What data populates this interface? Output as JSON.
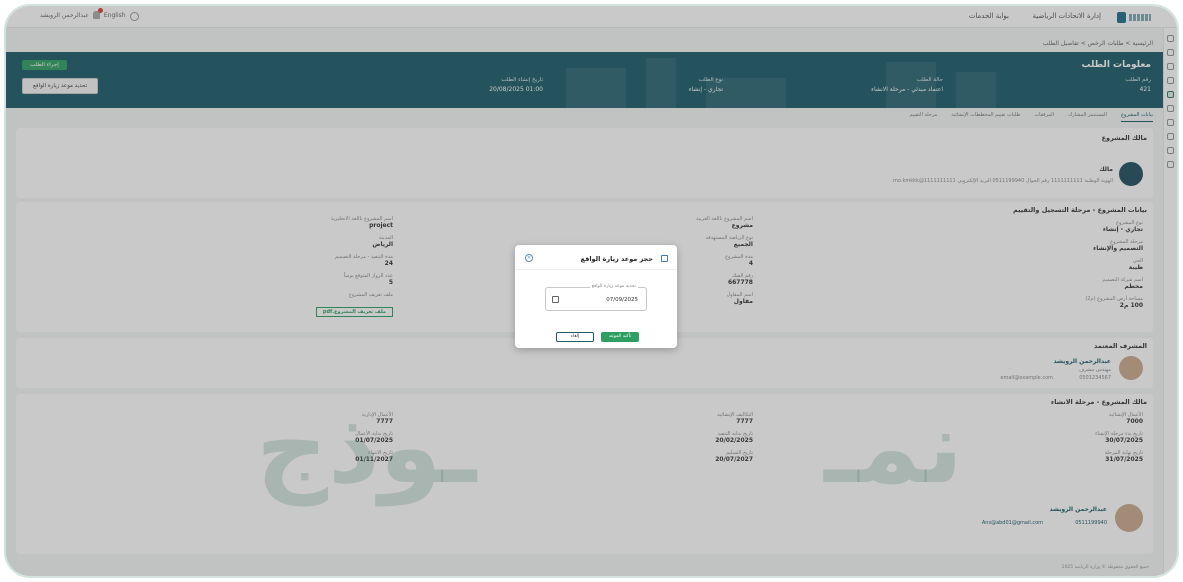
{
  "topbar": {
    "nav_1": "إدارة الاتحادات الرياضية",
    "nav_2": "بوابة الخدمات",
    "user_name": "عبدالرحمن الرويشد",
    "lang": "English",
    "brand_name": "وزارة الرياضة"
  },
  "breadcrumb": "الرئيسية > طلبات الرخص > تفاصيل الطلب",
  "hero": {
    "title": "معلومات الطلب",
    "req_no_label": "رقم الطلب",
    "req_no": "421",
    "status_label": "حالة الطلب",
    "status": "اعتماد مبدئي - مرحلة الانشاء",
    "type_label": "نوع الطلب",
    "type": "تجاري - إنشاء",
    "date_label": "تاريخ إنشاء الطلب",
    "date": "01:00 20/08/2025",
    "btn_primary": "إجراء الطلب",
    "btn_secondary": "تحديد موعد زيارة الواقع"
  },
  "tabs": [
    "بيانات المشروع",
    "المستثمر المشارك",
    "المرفقات",
    "طلبات تقييم المخططات الإنشائية",
    "مرحلة التقييم"
  ],
  "owner_section": {
    "heading": "مالك المشروع",
    "name": "مالك",
    "info": "الهوية الوطنية 1111111111 رقم الجوال 0511199940 البريد الإلكتروني mo.kmkkk@1111111111"
  },
  "project_section": {
    "heading": "بيانات المشروع - مرحلة التسجيل والتقييم",
    "fields": [
      {
        "label": "نوع المشروع",
        "value": "تجاري - إنشاء"
      },
      {
        "label": "مرحلة المشروع",
        "value": "التصميم والإنشاء"
      },
      {
        "label": "الحي",
        "value": "طيبة"
      },
      {
        "label": "اسم شركة التصميم",
        "value": "محطم"
      },
      {
        "label": "مساحة أرض المشروع (م2)",
        "value": "100 م2"
      },
      {
        "label": "اسم المشروع باللغة العربية",
        "value": "مشروع"
      },
      {
        "label": "نوع الرياضة المستهدفة",
        "value": "الجميع"
      },
      {
        "label": "مدة المشروع",
        "value": "4"
      },
      {
        "label": "رقم الصك",
        "value": "667778"
      },
      {
        "label": "اسم المقاول",
        "value": "مقاول"
      },
      {
        "label": "اسم المشروع باللغة الانجليزية",
        "value": "project"
      },
      {
        "label": "المدينة",
        "value": "الرياض"
      },
      {
        "label": "مدة التنفيذ - مرحلة التصميم",
        "value": "24"
      },
      {
        "label": "عدد الزوار المتوقع يومياً",
        "value": "5"
      },
      {
        "label": "ملف تعريف المشروع",
        "value": "ملف تعريف المشروع.pdf"
      }
    ]
  },
  "supervisor_section": {
    "heading": "المشرف المعتمد",
    "name": "عبدالرحمن الرويشد",
    "role": "مهندس مشرف",
    "phone": "0501234567",
    "email": "email@example.com"
  },
  "construction_section": {
    "heading": "مالك المشروع - مرحلة الانشاء",
    "fields": [
      {
        "label": "الأعمال الإنشائية",
        "value": "7000"
      },
      {
        "label": "تاريخ بدء مرحلة الإنشاء",
        "value": "30/07/2025"
      },
      {
        "label": "تاريخ نهاية المرحلة",
        "value": "31/07/2025"
      },
      {
        "label": "التكاليف الإنشائية",
        "value": "7777"
      },
      {
        "label": "تاريخ بداية التنفيذ",
        "value": "20/02/2025"
      },
      {
        "label": "تاريخ التسليم",
        "value": "20/07/2027"
      },
      {
        "label": "الأعمال الإدارية",
        "value": "7777"
      },
      {
        "label": "تاريخ بداية الأعمال",
        "value": "01/07/2025"
      },
      {
        "label": "تاريخ الانتهاء",
        "value": "01/11/2027"
      }
    ],
    "contact_name": "عبدالرحمن الرويشد",
    "contact_phone": "0511199940",
    "contact_email": "Ans@abd01@gmail.com"
  },
  "watermark": {
    "right": "نمـ",
    "left": "ـوذج"
  },
  "modal": {
    "title": "حجز موعد زيارة الواقع",
    "date_legend": "تحديد موعد زيارة الواقع",
    "date_value": "07/09/2025",
    "ok": "تأكيد الموعد",
    "cancel": "إلغاء"
  },
  "footer": "جميع الحقوق محفوظة © وزارة الرياضة 2025"
}
